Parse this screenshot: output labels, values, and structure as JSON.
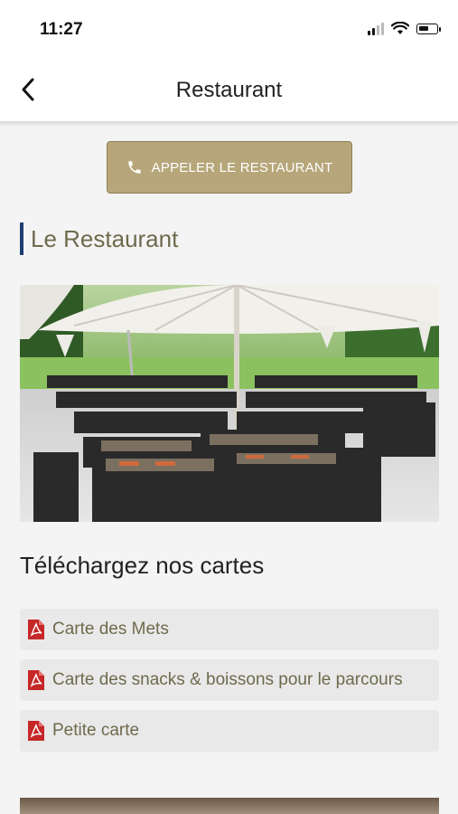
{
  "status": {
    "time": "11:27",
    "battery_level": 0.6,
    "signal_bars_active": 2,
    "signal_bars_total": 4
  },
  "nav": {
    "title": "Restaurant",
    "back_icon": "chevron-left-icon"
  },
  "call_button": {
    "label": "APPELER LE RESTAURANT",
    "icon": "phone-icon",
    "color": "#b6a67a"
  },
  "section": {
    "title": "Le Restaurant",
    "accent": "#1f3e74"
  },
  "photo": {
    "description_icon": "restaurant-terrace-photo"
  },
  "downloads": {
    "title": "Téléchargez nos cartes",
    "items": [
      {
        "label": "Carte des Mets",
        "icon": "pdf-icon"
      },
      {
        "label": "Carte des snacks & boissons pour le parcours",
        "icon": "pdf-icon"
      },
      {
        "label": "Petite carte",
        "icon": "pdf-icon"
      }
    ]
  },
  "colors": {
    "pdf_red": "#c62828",
    "label_text": "#6e6a4d"
  }
}
